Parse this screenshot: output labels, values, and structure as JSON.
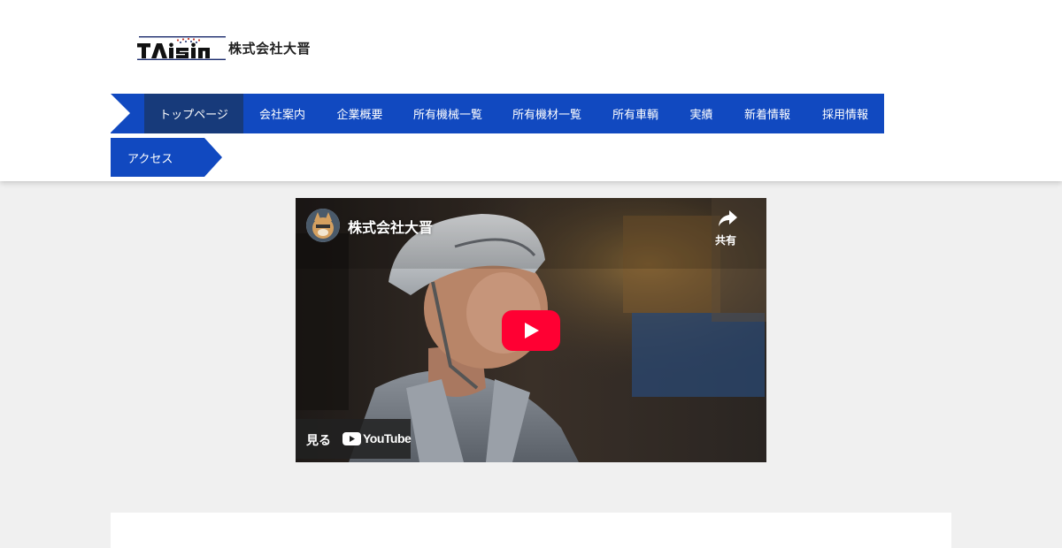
{
  "header": {
    "logo": {
      "brand_text": "TAiSin",
      "company_name": "株式会社大晋"
    }
  },
  "nav": {
    "items": [
      {
        "label": "トップページ",
        "active": true
      },
      {
        "label": "会社案内"
      },
      {
        "label": "企業概要"
      },
      {
        "label": "所有機械一覧"
      },
      {
        "label": "所有機材一覧"
      },
      {
        "label": "所有車輌"
      },
      {
        "label": "実績"
      },
      {
        "label": "新着情報"
      },
      {
        "label": "採用情報"
      }
    ],
    "second_row": {
      "label": "アクセス"
    },
    "colors": {
      "bar": "#1149c0",
      "active": "#173a7a"
    }
  },
  "video": {
    "channel_name": "株式会社大晋",
    "share_label": "共有",
    "watch_label": "見る",
    "youtube_label": "YouTube",
    "icons": [
      "channel-avatar",
      "share-icon",
      "play-icon",
      "youtube-logo-icon"
    ],
    "colors": {
      "play": "#ff0033"
    }
  }
}
